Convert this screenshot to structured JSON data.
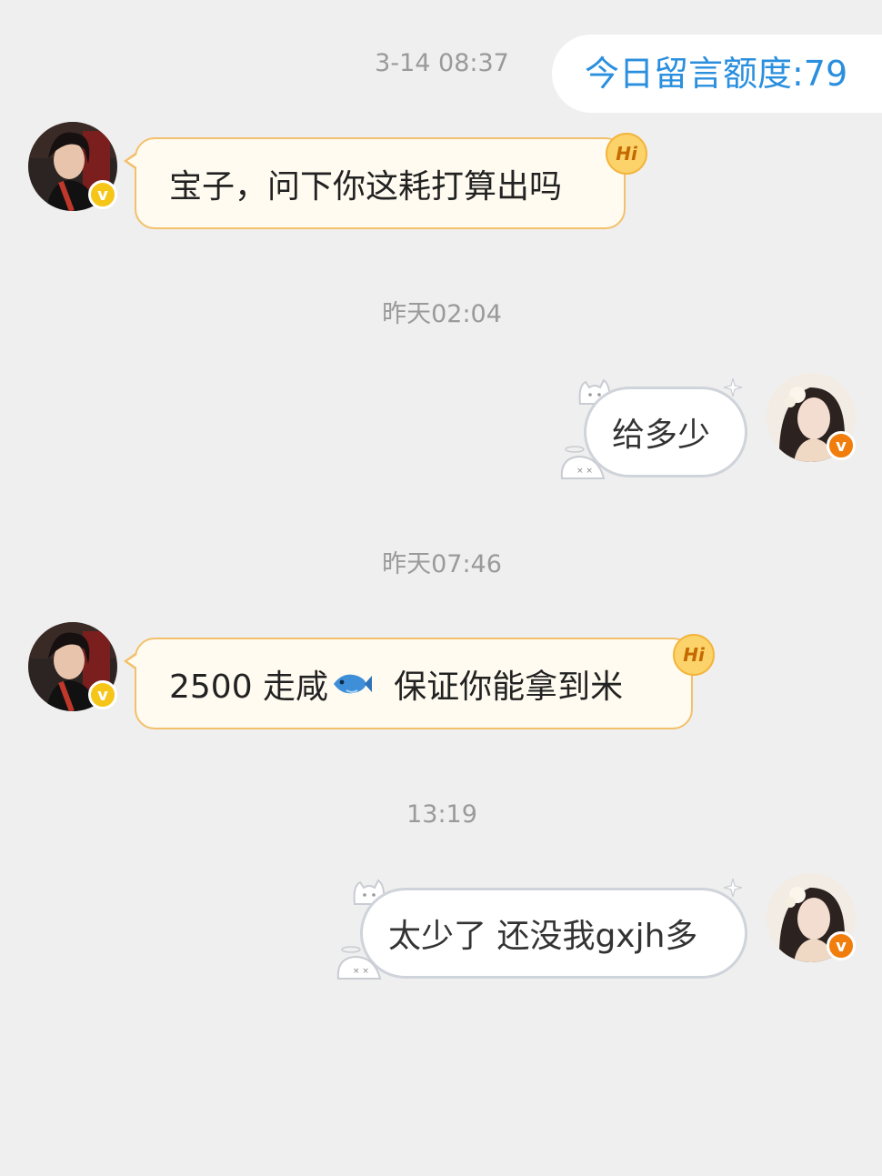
{
  "header": {
    "quota_label": "今日留言额度:79"
  },
  "colors": {
    "accent": "#2a8fde",
    "incoming_bubble_border": "#f3c06b",
    "outgoing_bubble_border": "#cfd3da",
    "background": "#efefef"
  },
  "messages": [
    {
      "timestamp": "3-14 08:37",
      "side": "left",
      "text": "宝子，问下你这耗打算出吗",
      "badge": "Hi"
    },
    {
      "timestamp": "昨天02:04",
      "side": "right",
      "text": "给多少"
    },
    {
      "timestamp": "昨天07:46",
      "side": "left",
      "text_parts": [
        "2500  走咸",
        "保证你能拿到米"
      ],
      "emoji": "fish-icon",
      "badge": "Hi"
    },
    {
      "timestamp": "13:19",
      "side": "right",
      "text": "太少了  还没我gxjh多"
    }
  ],
  "avatars": {
    "verified_badge_glyph": "v"
  }
}
